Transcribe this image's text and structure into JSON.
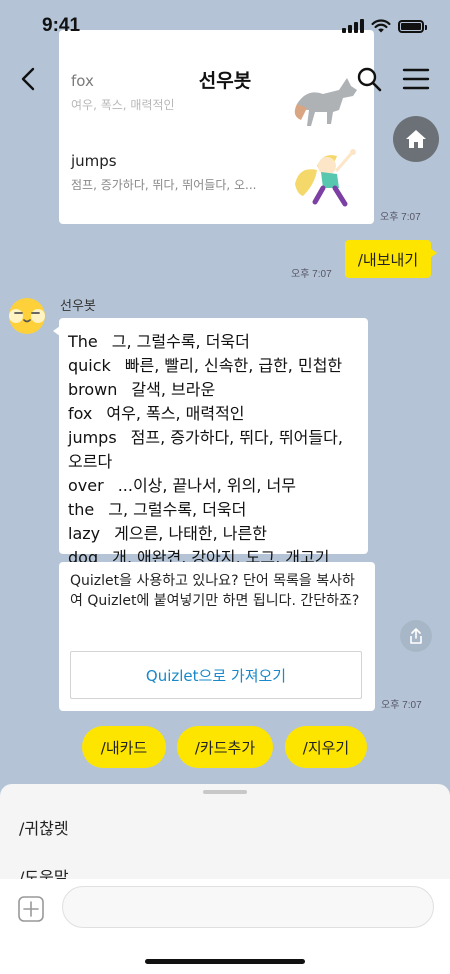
{
  "status_bar": {
    "time": "9:41"
  },
  "header": {
    "title": "선우봇"
  },
  "vocab_card": {
    "rows": [
      {
        "word": "fox",
        "definition": "여우, 폭스, 매력적인"
      },
      {
        "word": "jumps",
        "definition": "점프, 증가하다, 뛰다, 뛰어들다, 오..."
      }
    ],
    "time": "오후 7:07"
  },
  "my_message": {
    "text": "/내보내기",
    "time": "오후 7:07"
  },
  "bot": {
    "name": "선우봇"
  },
  "word_list": [
    {
      "word": "The",
      "meaning": "그, 그럴수록, 더욱더"
    },
    {
      "word": "quick",
      "meaning": "빠른, 빨리, 신속한, 급한, 민첩한"
    },
    {
      "word": "brown",
      "meaning": "갈색, 브라운"
    },
    {
      "word": "fox",
      "meaning": "여우, 폭스, 매력적인"
    },
    {
      "word": "jumps",
      "meaning": "점프, 증가하다, 뛰다, 뛰어들다,"
    },
    {
      "word": "",
      "meaning": "오르다"
    },
    {
      "word": "over",
      "meaning": "...이상, 끝나서, 위의, 너무"
    },
    {
      "word": "the",
      "meaning": "그, 그럴수록, 더욱더"
    },
    {
      "word": "lazy",
      "meaning": "게으른, 나태한, 나른한"
    },
    {
      "word": "dog",
      "meaning": "개, 애완견, 강아지, 도그, 개고기"
    }
  ],
  "quizlet_card": {
    "text": "Quizlet을 사용하고 있나요? 단어 목록을 복사하여 Quizlet에 붙여넣기만 하면 됩니다. 간단하죠?",
    "button_label": "Quizlet으로 가져오기",
    "time": "오후 7:07"
  },
  "quick_replies": [
    "/내카드",
    "/카드추가",
    "/지우기"
  ],
  "command_sheet": {
    "items": [
      "/귀찮렛",
      "/도움말"
    ]
  },
  "input": {
    "value": "",
    "placeholder": ""
  },
  "colors": {
    "background": "#b4c4d6",
    "yellow": "#fee500",
    "link_blue": "#1a88c9"
  },
  "icons": {
    "back": "chevron-left-icon",
    "search": "search-icon",
    "menu": "hamburger-icon",
    "home": "home-icon",
    "share": "share-icon",
    "plus": "plus-square-icon"
  }
}
